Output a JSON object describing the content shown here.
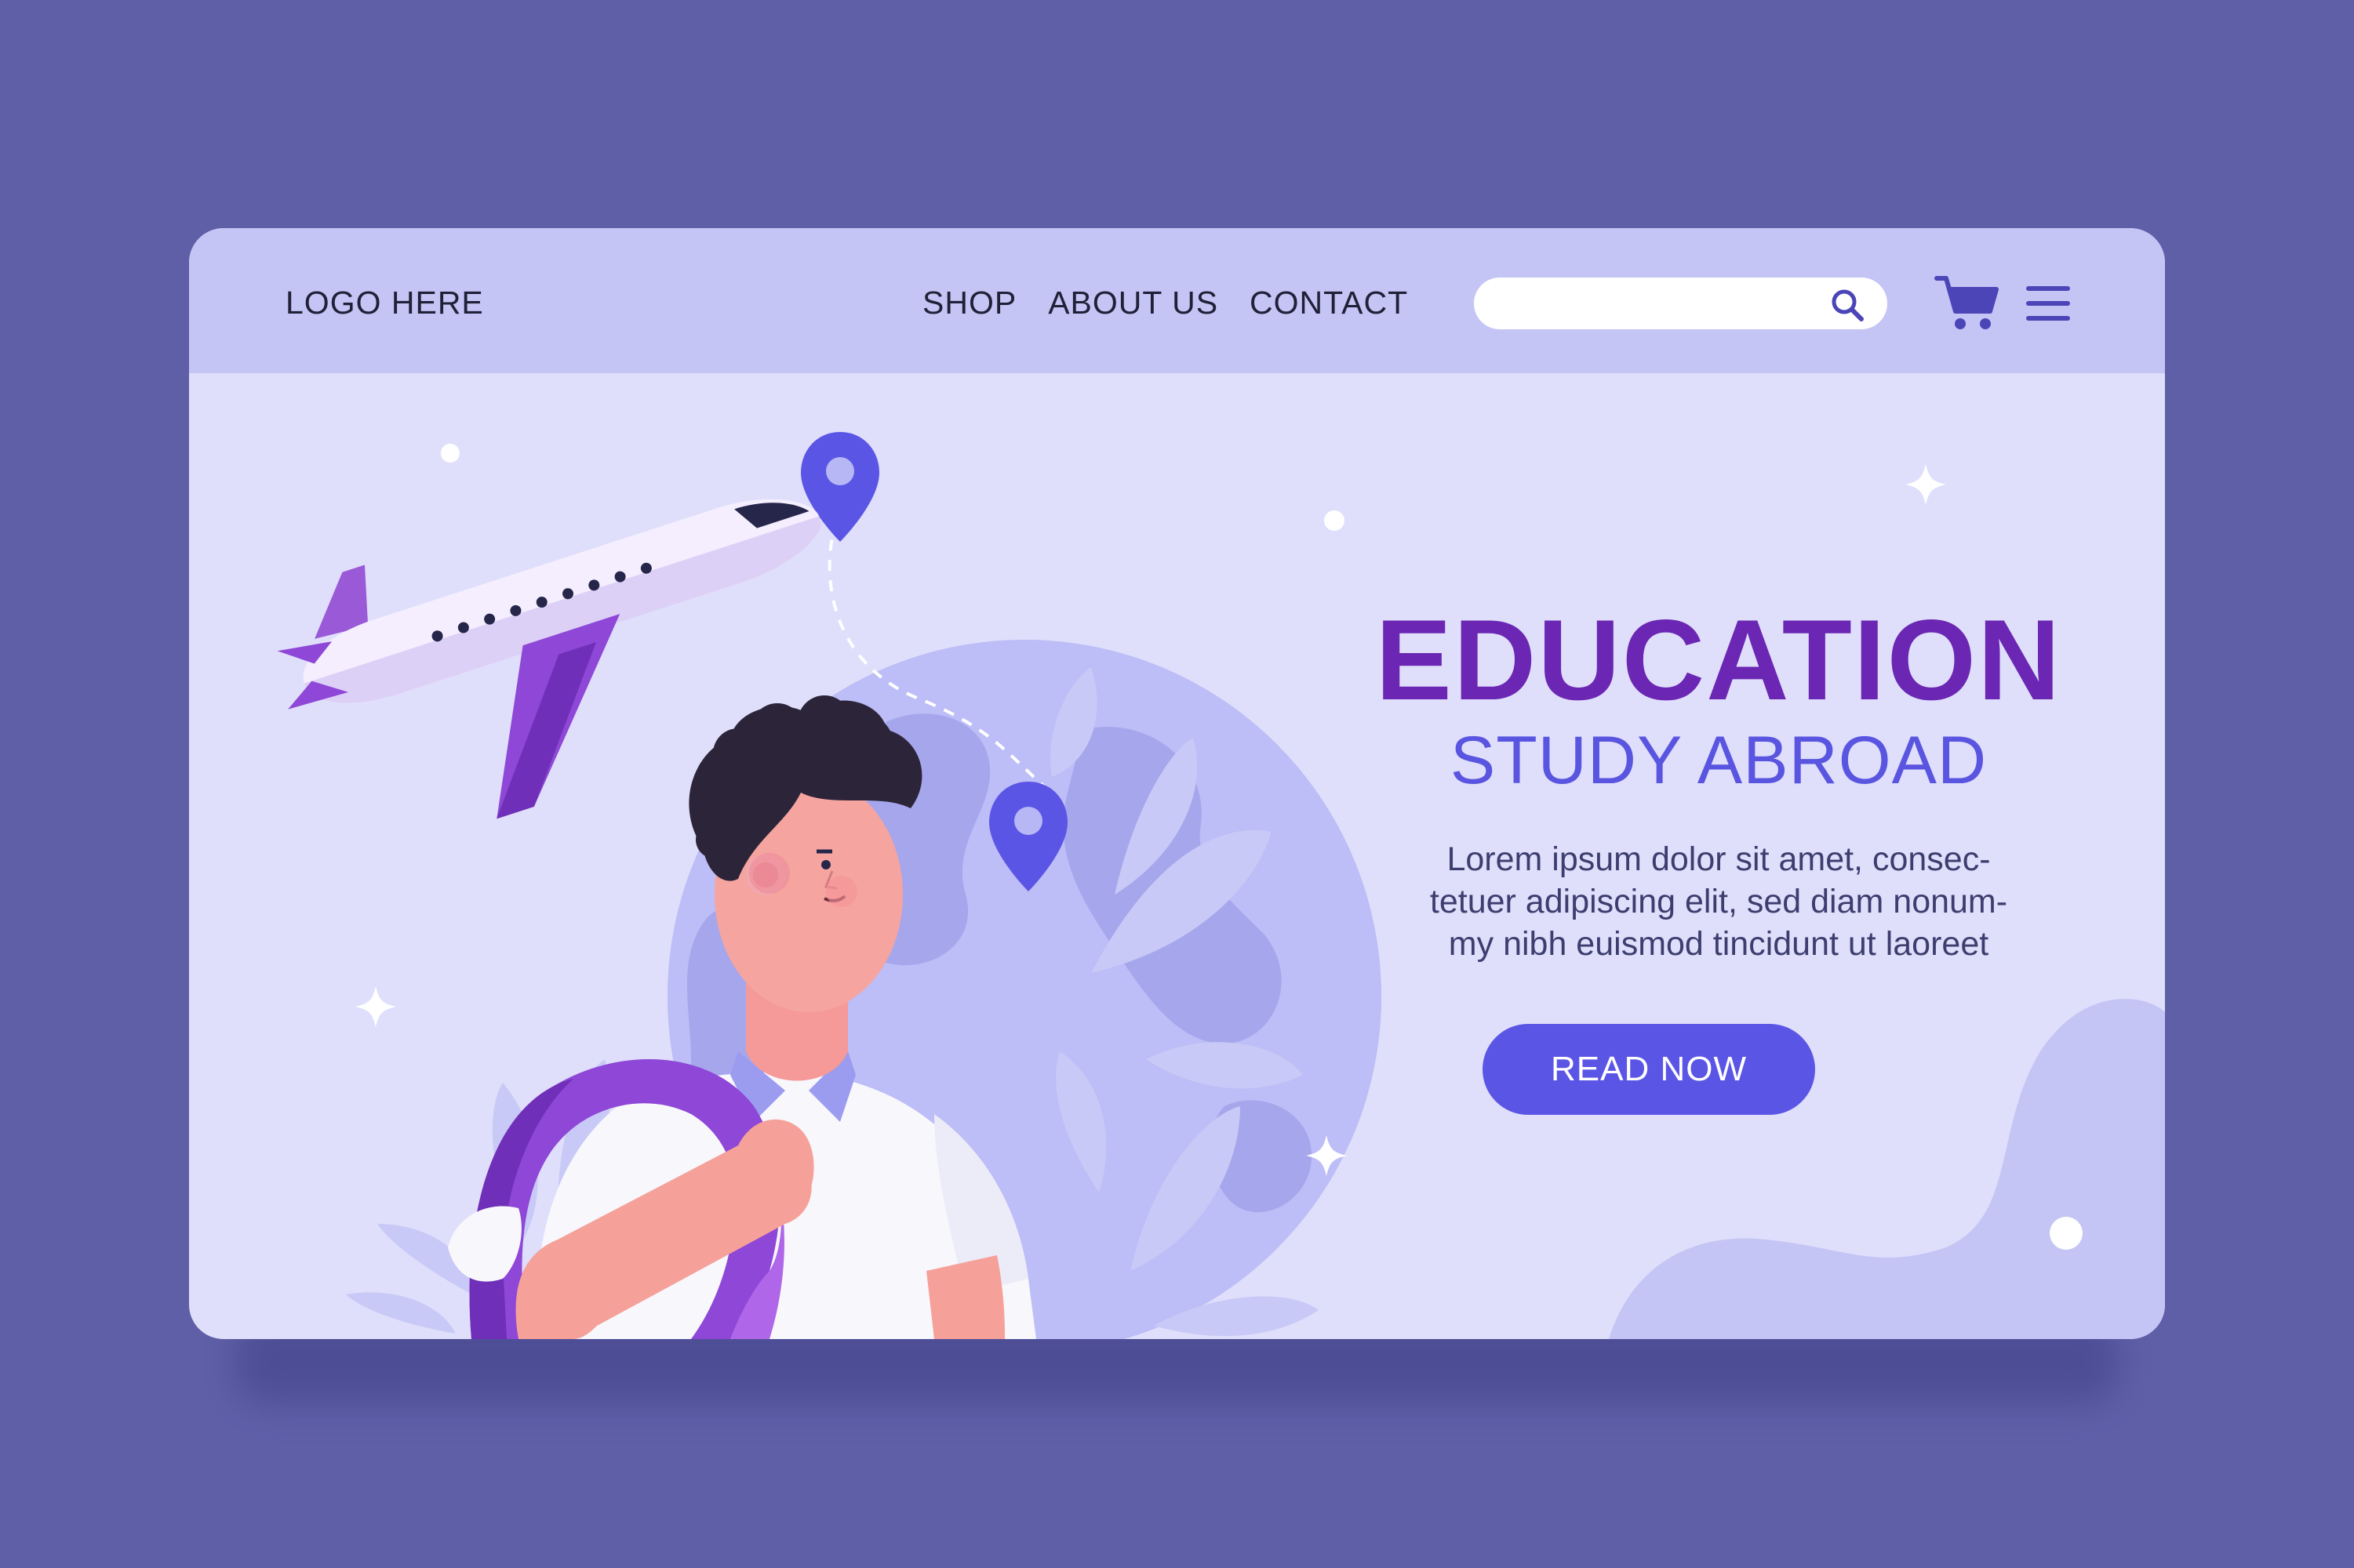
{
  "header": {
    "logo": "LOGO HERE",
    "nav": [
      {
        "label": "SHOP"
      },
      {
        "label": "ABOUT US"
      },
      {
        "label": "CONTACT"
      }
    ],
    "search": {
      "value": "",
      "placeholder": ""
    }
  },
  "hero": {
    "title": "EDUCATION",
    "subtitle": "STUDY ABROAD",
    "body_lines": [
      "Lorem ipsum dolor sit amet, consec-",
      "tetuer adipiscing elit, sed diam nonum-",
      "my nibh euismod tincidunt ut laoreet"
    ],
    "cta_label": "READ NOW"
  },
  "icons": {
    "search": "search-icon",
    "cart": "cart-icon",
    "menu": "hamburger-menu-icon",
    "location_pin": "location-pin-icon",
    "sparkle": "sparkle-icon"
  },
  "colors": {
    "page_background": "#5f5fa8",
    "nav_background": "#c5c5f5",
    "content_background": "#dfdffb",
    "title": "#6b27b3",
    "subtitle": "#5a55e0",
    "button": "#5b55e6",
    "button_text": "#ffffff",
    "body_text": "#3d3d70"
  }
}
